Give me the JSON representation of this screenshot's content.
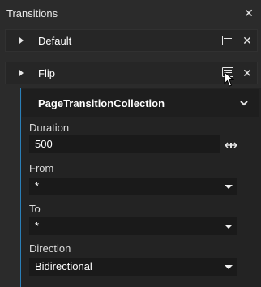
{
  "header": {
    "title": "Transitions"
  },
  "items": [
    {
      "label": "Default"
    },
    {
      "label": "Flip"
    }
  ],
  "popup": {
    "title": "PageTransitionCollection",
    "duration": {
      "label": "Duration",
      "value": "500"
    },
    "from": {
      "label": "From",
      "value": "*"
    },
    "to": {
      "label": "To",
      "value": "*"
    },
    "direction": {
      "label": "Direction",
      "value": "Bidirectional"
    }
  },
  "icons": {
    "close": "close-icon",
    "expand": "triangle-right-icon",
    "edit": "panel-icon",
    "cursor": "mouse-pointer-icon",
    "collapse": "chevron-down-icon",
    "resize": "horizontal-resize-icon",
    "dropdown": "caret-down-icon"
  },
  "colors": {
    "accent": "#2a7fb8",
    "background": "#2b2b2b",
    "field": "#1a1a1a"
  }
}
